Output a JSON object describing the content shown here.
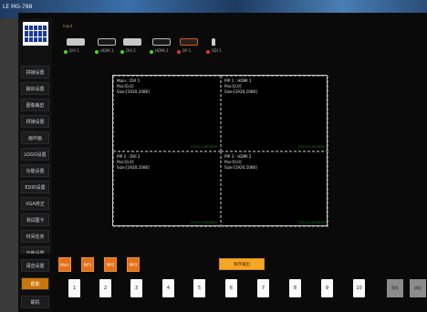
{
  "window": {
    "title": "LE MG-788"
  },
  "sidebar": {
    "items": [
      {
        "label": "拼接设置"
      },
      {
        "label": "输出设置"
      },
      {
        "label": "图像裁剪"
      },
      {
        "label": "拼接设置"
      },
      {
        "label": "画中画"
      },
      {
        "label": "LOGO设置"
      },
      {
        "label": "功能设置"
      },
      {
        "label": "EDID设置"
      },
      {
        "label": "VGA校正"
      },
      {
        "label": "测试图卡"
      },
      {
        "label": "时间任务"
      },
      {
        "label": "功能设置"
      },
      {
        "label": "语音设置"
      },
      {
        "label": "帮助"
      },
      {
        "label": "联机"
      }
    ]
  },
  "input_panel": {
    "label": "Input",
    "ports": [
      {
        "label": "DVI 1",
        "status": "green"
      },
      {
        "label": "HDMI 1",
        "status": "green"
      },
      {
        "label": "DVI 2",
        "status": "green"
      },
      {
        "label": "HDMI 2",
        "status": "green"
      },
      {
        "label": "DP 1",
        "status": "red"
      },
      {
        "label": "SDI 1",
        "status": "red"
      }
    ]
  },
  "preview": {
    "panes": [
      {
        "name": "Main : DVI 1",
        "pos": "Pos:[0,0]",
        "size": "Size:[1920,1080]",
        "res": "1920×1080@60"
      },
      {
        "name": "PIP 1 : HDMI 1",
        "pos": "Pos:[0,0]",
        "size": "Size:[1920,1080]",
        "res": "1920×1080@60"
      },
      {
        "name": "PIP 2 : DVI 2",
        "pos": "Pos:[0,0]",
        "size": "Size:[1920,1080]",
        "res": "1920×1080@60"
      },
      {
        "name": "PIP 3 : HDMI 2",
        "pos": "Pos:[0,0]",
        "size": "Size:[1920,1080]",
        "res": "1920×1080@60"
      }
    ]
  },
  "controls": {
    "mode_buttons": [
      "Main",
      "PIP1",
      "PIP2",
      "PIP3"
    ],
    "save_label": "保存输出",
    "presets": [
      "1",
      "2",
      "3",
      "4",
      "5",
      "6",
      "7",
      "8",
      "9",
      "10"
    ],
    "gray_buttons": [
      "保存",
      "调用"
    ]
  },
  "colors": {
    "accent": "#e3701a",
    "save_button": "#f5a623",
    "status_ok": "#4cd22b",
    "status_err": "#e5352b"
  }
}
